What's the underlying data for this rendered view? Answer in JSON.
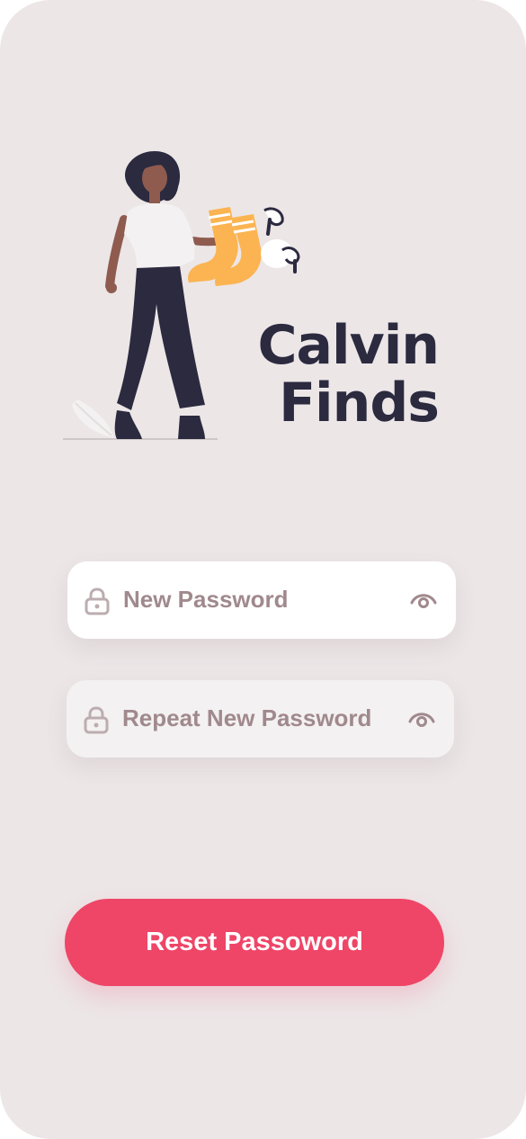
{
  "brand": {
    "line1": "Calvin",
    "line2": "Finds"
  },
  "form": {
    "new_password_placeholder": "New Password",
    "repeat_password_placeholder": "Repeat New Password",
    "lock_icon": "lock-icon",
    "eye_icon": "eye-icon"
  },
  "actions": {
    "reset_label": "Reset Passoword"
  },
  "colors": {
    "background": "#ece6e7",
    "brand_text": "#2b2a3f",
    "placeholder": "#a0898d",
    "button": "#ef4567"
  }
}
